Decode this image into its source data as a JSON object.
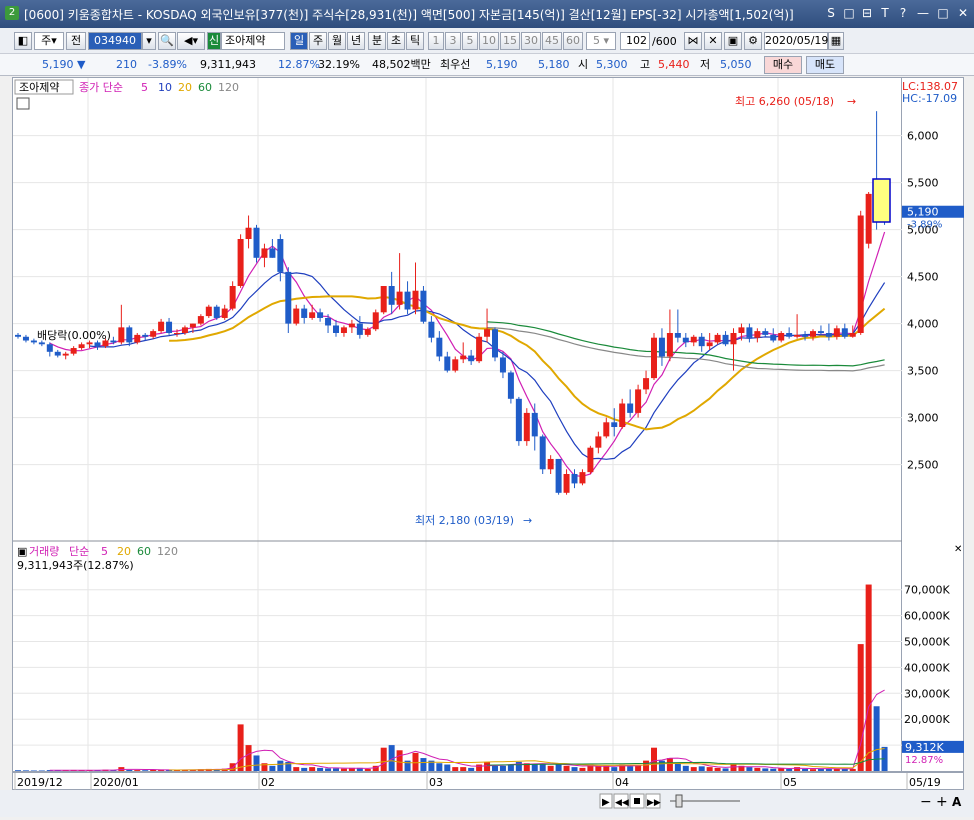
{
  "titlebar": {
    "window_num": "2",
    "title": "[0600] 키움종합차트 - KOSDAQ 외국인보유[377(천)] 주식수[28,931(천)] 액면[500] 자본금[145(억)] 결산[12월] EPS[-32] 시가총액[1,502(억)]",
    "controls": [
      "S",
      "□",
      "⊟",
      "T",
      "?",
      "—",
      "□",
      "✕"
    ]
  },
  "toolbar1": {
    "type_label": "주",
    "prev_label": "전",
    "code": "034940",
    "badge": "신",
    "stock_name": "조아제약",
    "periods": [
      "일",
      "주",
      "월",
      "년",
      "분",
      "초",
      "틱"
    ],
    "minutes": [
      "1",
      "3",
      "5",
      "10",
      "15",
      "30",
      "45",
      "60"
    ],
    "min_select": "5",
    "count": "102",
    "count_total": "/600",
    "date": "2020/05/19"
  },
  "toolbar2": {
    "price": "5,190 ▼",
    "change": "210",
    "change_pct": "-3.89%",
    "volume": "9,311,943",
    "vol_pct": "12.87%",
    "turnover": "32.19%",
    "amount": "48,502백만",
    "best_label": "최우선",
    "bid": "5,190",
    "ask": "5,180",
    "open_label": "시",
    "open": "5,300",
    "high_label": "고",
    "high": "5,440",
    "low_label": "저",
    "low": "5,050",
    "buy": "매수",
    "sell": "매도"
  },
  "price_panel": {
    "name_tag": "조아제약",
    "legend_prefix": "종가 단순",
    "ma_labels": [
      "5",
      "10",
      "20",
      "60",
      "120"
    ],
    "ma_colors": [
      "#d01fb4",
      "#1f3fbf",
      "#e0a800",
      "#1a8a3a",
      "#888888"
    ],
    "lc": "LC:138.07",
    "hc": "HC:-17.09",
    "high_annot": "최고 6,260 (05/18)",
    "low_annot": "최저 2,180 (03/19)",
    "div_annot": "배당락(0.00%)",
    "cur_price": "5,190",
    "cur_pct": "-3.89%",
    "ticks": [
      "6,000",
      "5,500",
      "5,000",
      "4,500",
      "4,000",
      "3,500",
      "3,000",
      "2,500"
    ]
  },
  "volume_panel": {
    "name": "거래량",
    "legend_prefix": "단순",
    "ma_labels": [
      "5",
      "20",
      "60",
      "120"
    ],
    "ma_colors": [
      "#d01fb4",
      "#e0a800",
      "#1a8a3a",
      "#888888"
    ],
    "summary": "9,311,943주(12.87%)",
    "cur": "9,312K",
    "cur_pct": "12.87%",
    "ticks": [
      "70,000K",
      "60,000K",
      "50,000K",
      "40,000K",
      "30,000K",
      "20,000K",
      "10,000K"
    ]
  },
  "dates": [
    "2019/12",
    "2020/01",
    "02",
    "03",
    "04",
    "05",
    "05/19"
  ],
  "colors": {
    "up": "#e8201a",
    "down": "#1f5cc8",
    "accent": "#2a5fb7"
  },
  "chart_data": {
    "type": "candlestick",
    "start_date": "2019/12/19",
    "ohlc": [
      [
        3880,
        3900,
        3840,
        3860
      ],
      [
        3860,
        3880,
        3800,
        3820
      ],
      [
        3820,
        3840,
        3780,
        3800
      ],
      [
        3800,
        3820,
        3760,
        3780
      ],
      [
        3780,
        3800,
        3650,
        3700
      ],
      [
        3700,
        3720,
        3640,
        3660
      ],
      [
        3660,
        3700,
        3620,
        3680
      ],
      [
        3680,
        3760,
        3660,
        3740
      ],
      [
        3740,
        3800,
        3720,
        3780
      ],
      [
        3780,
        3820,
        3740,
        3800
      ],
      [
        3800,
        3820,
        3720,
        3760
      ],
      [
        3760,
        3840,
        3740,
        3820
      ],
      [
        3820,
        3860,
        3780,
        3800
      ],
      [
        3800,
        4200,
        3780,
        3960
      ],
      [
        3960,
        3980,
        3760,
        3800
      ],
      [
        3800,
        3900,
        3780,
        3880
      ],
      [
        3880,
        3900,
        3820,
        3860
      ],
      [
        3860,
        3940,
        3840,
        3920
      ],
      [
        3920,
        4050,
        3900,
        4020
      ],
      [
        4020,
        4060,
        3880,
        3900
      ],
      [
        3900,
        3940,
        3860,
        3900
      ],
      [
        3900,
        3980,
        3880,
        3960
      ],
      [
        3960,
        4000,
        3900,
        4000
      ],
      [
        4000,
        4100,
        3980,
        4080
      ],
      [
        4080,
        4200,
        4060,
        4180
      ],
      [
        4180,
        4200,
        4040,
        4060
      ],
      [
        4060,
        4200,
        4040,
        4160
      ],
      [
        4160,
        4450,
        4140,
        4400
      ],
      [
        4400,
        4950,
        4380,
        4900
      ],
      [
        4900,
        5150,
        4800,
        5020
      ],
      [
        5020,
        5050,
        4650,
        4700
      ],
      [
        4700,
        4850,
        4600,
        4800
      ],
      [
        4800,
        4900,
        4700,
        4700
      ],
      [
        4900,
        4950,
        4450,
        4550
      ],
      [
        4550,
        4600,
        3900,
        4000
      ],
      [
        4000,
        4200,
        3980,
        4160
      ],
      [
        4160,
        4200,
        4000,
        4060
      ],
      [
        4060,
        4200,
        4040,
        4120
      ],
      [
        4120,
        4160,
        4020,
        4060
      ],
      [
        4060,
        4100,
        3900,
        3980
      ],
      [
        3980,
        4040,
        3860,
        3900
      ],
      [
        3900,
        3980,
        3860,
        3960
      ],
      [
        3960,
        4040,
        3900,
        4000
      ],
      [
        4000,
        4080,
        3840,
        3880
      ],
      [
        3880,
        3960,
        3860,
        3940
      ],
      [
        3940,
        4150,
        3920,
        4120
      ],
      [
        4120,
        4400,
        4100,
        4400
      ],
      [
        4400,
        4550,
        4100,
        4200
      ],
      [
        4200,
        4750,
        4150,
        4340
      ],
      [
        4340,
        4450,
        4100,
        4150
      ],
      [
        4150,
        4650,
        4100,
        4350
      ],
      [
        4350,
        4400,
        4000,
        4020
      ],
      [
        4020,
        4080,
        3800,
        3850
      ],
      [
        3850,
        3920,
        3600,
        3650
      ],
      [
        3650,
        3700,
        3480,
        3500
      ],
      [
        3500,
        3650,
        3480,
        3620
      ],
      [
        3620,
        3800,
        3580,
        3660
      ],
      [
        3660,
        3720,
        3560,
        3600
      ],
      [
        3600,
        3900,
        3580,
        3860
      ],
      [
        3860,
        4160,
        3800,
        3940
      ],
      [
        3940,
        3960,
        3600,
        3640
      ],
      [
        3640,
        3700,
        3420,
        3480
      ],
      [
        3480,
        3500,
        3150,
        3200
      ],
      [
        3200,
        3220,
        2700,
        2750
      ],
      [
        2750,
        3100,
        2700,
        3050
      ],
      [
        3050,
        3150,
        2650,
        2800
      ],
      [
        2800,
        2820,
        2400,
        2450
      ],
      [
        2450,
        2600,
        2400,
        2560
      ],
      [
        2560,
        2560,
        2180,
        2200
      ],
      [
        2200,
        2450,
        2180,
        2400
      ],
      [
        2400,
        2450,
        2250,
        2300
      ],
      [
        2300,
        2450,
        2280,
        2420
      ],
      [
        2420,
        2700,
        2400,
        2680
      ],
      [
        2680,
        2850,
        2620,
        2800
      ],
      [
        2800,
        3000,
        2780,
        2950
      ],
      [
        2950,
        3100,
        2800,
        2900
      ],
      [
        2900,
        3200,
        2880,
        3150
      ],
      [
        3150,
        3300,
        3000,
        3050
      ],
      [
        3050,
        3350,
        3000,
        3300
      ],
      [
        3300,
        3500,
        3250,
        3420
      ],
      [
        3420,
        3900,
        3400,
        3850
      ],
      [
        3850,
        3950,
        3550,
        3650
      ],
      [
        3650,
        4150,
        3600,
        3900
      ],
      [
        3900,
        4150,
        3800,
        3850
      ],
      [
        3850,
        3900,
        3750,
        3800
      ],
      [
        3800,
        3880,
        3760,
        3860
      ],
      [
        3860,
        3900,
        3700,
        3760
      ],
      [
        3760,
        3900,
        3720,
        3800
      ],
      [
        3800,
        3900,
        3780,
        3880
      ],
      [
        3880,
        3920,
        3760,
        3780
      ],
      [
        3780,
        3950,
        3500,
        3900
      ],
      [
        3900,
        4000,
        3820,
        3960
      ],
      [
        3960,
        4000,
        3800,
        3850
      ],
      [
        3850,
        3950,
        3800,
        3920
      ],
      [
        3920,
        3950,
        3860,
        3880
      ],
      [
        3880,
        3950,
        3800,
        3820
      ],
      [
        3820,
        3920,
        3800,
        3900
      ],
      [
        3900,
        3960,
        3840,
        3860
      ],
      [
        3860,
        4100,
        3840,
        3880
      ],
      [
        3880,
        3920,
        3820,
        3860
      ],
      [
        3860,
        3940,
        3820,
        3920
      ],
      [
        3920,
        3980,
        3880,
        3900
      ],
      [
        3900,
        4000,
        3820,
        3860
      ],
      [
        3860,
        3980,
        3830,
        3950
      ],
      [
        3950,
        4000,
        3840,
        3860
      ],
      [
        3860,
        3980,
        3850,
        3900
      ],
      [
        3900,
        5200,
        3880,
        5150
      ],
      [
        4850,
        5400,
        4800,
        5380
      ],
      [
        5380,
        6260,
        5000,
        5250
      ],
      [
        5300,
        5440,
        5050,
        5190
      ]
    ],
    "volume_k": [
      300,
      250,
      200,
      200,
      350,
      300,
      250,
      400,
      300,
      250,
      300,
      500,
      300,
      1500,
      400,
      350,
      300,
      400,
      600,
      400,
      300,
      400,
      500,
      700,
      800,
      600,
      900,
      3000,
      18000,
      10000,
      6000,
      3000,
      2000,
      4000,
      3500,
      1500,
      1200,
      1500,
      1200,
      1000,
      1000,
      900,
      1200,
      1200,
      800,
      2000,
      9000,
      10000,
      8000,
      4000,
      7000,
      5000,
      4000,
      3000,
      2500,
      1500,
      1500,
      1200,
      2500,
      3500,
      2000,
      2000,
      2500,
      3500,
      3000,
      2800,
      2500,
      2000,
      3000,
      2000,
      1500,
      1200,
      2500,
      1800,
      2000,
      1500,
      2500,
      1800,
      2500,
      4000,
      9000,
      4000,
      5000,
      3000,
      2000,
      1500,
      1800,
      1500,
      1200,
      1000,
      2500,
      2000,
      1500,
      1200,
      1000,
      900,
      1000,
      800,
      1500,
      800,
      700,
      800,
      900,
      1000,
      900,
      800,
      49000,
      72000,
      25000,
      9312
    ]
  }
}
